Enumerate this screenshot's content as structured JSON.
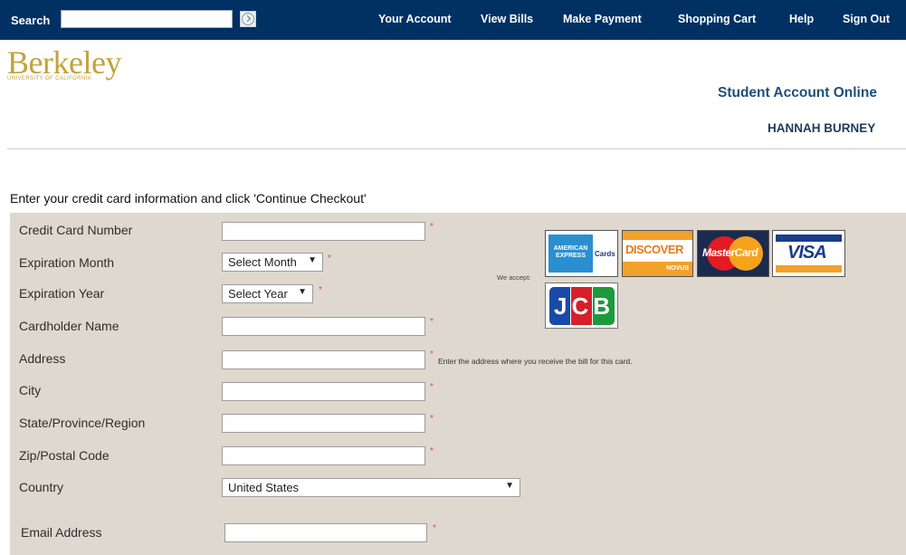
{
  "header": {
    "search_label": "Search",
    "search_value": "",
    "nav": [
      "Your Account",
      "View Bills",
      "Make Payment",
      "Shopping Cart",
      "Help",
      "Sign Out"
    ]
  },
  "logo": {
    "word": "Berkeley",
    "sub": "UNIVERSITY OF CALIFORNIA"
  },
  "site_title": "Student Account Online",
  "user_name": "HANNAH BURNEY",
  "form": {
    "instructions": "Enter your credit card information and click 'Continue Checkout'",
    "labels": {
      "card_number": "Credit Card Number",
      "exp_month": "Expiration Month",
      "exp_year": "Expiration Year",
      "cardholder": "Cardholder Name",
      "address": "Address",
      "city": "City",
      "state": "State/Province/Region",
      "zip": "Zip/Postal Code",
      "country": "Country",
      "email": "Email Address"
    },
    "required_mark": "*",
    "exp_month_value": "Select Month",
    "exp_year_value": "Select Year",
    "country_value": "United States",
    "address_hint": "Enter the address where you receive the bill for this card.",
    "we_accept": "We accept:"
  },
  "cards": {
    "amex": {
      "line1": "AMERICAN",
      "line2": "EXPRESS",
      "suffix": "Cards"
    },
    "discover": {
      "text": "DISCOVER",
      "sub": "NOVUS"
    },
    "mastercard": {
      "text": "MasterCard"
    },
    "visa": {
      "text": "VISA"
    },
    "jcb": {
      "text": "JCB"
    }
  },
  "colors": {
    "topbar": "#013063",
    "brand_gold": "#c4a23a",
    "form_bg": "#ded8ce",
    "required": "#e04a4a"
  }
}
